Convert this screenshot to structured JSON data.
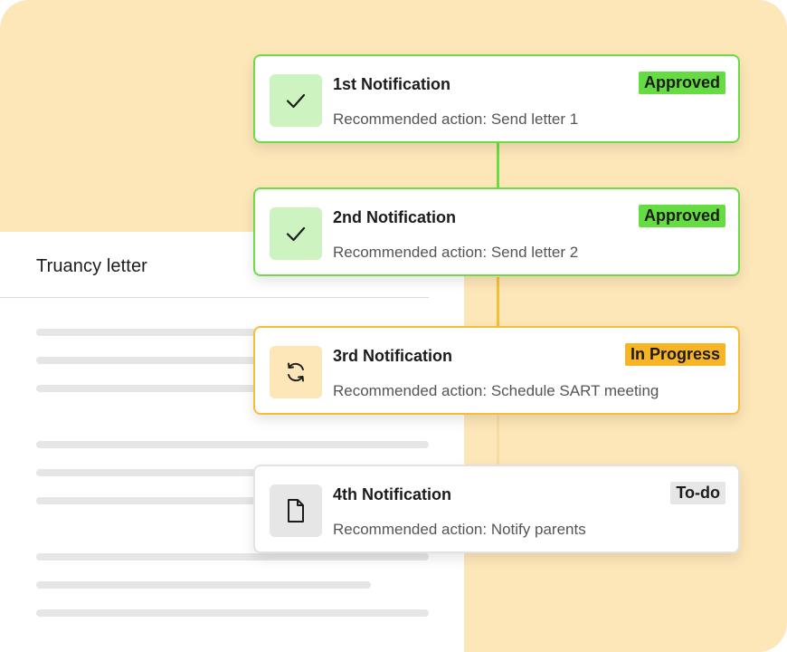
{
  "document": {
    "title": "Truancy letter"
  },
  "notifications": [
    {
      "title": "1st Notification",
      "action": "Recommended action: Send letter 1",
      "status": "Approved",
      "icon": "check-icon",
      "status_color": "#66dc43"
    },
    {
      "title": "2nd Notification",
      "action": "Recommended action: Send letter 2",
      "status": "Approved",
      "icon": "check-icon",
      "status_color": "#66dc43"
    },
    {
      "title": "3rd Notification",
      "action": "Recommended action: Schedule SART meeting",
      "status": "In Progress",
      "icon": "refresh-icon",
      "status_color": "#f7b424"
    },
    {
      "title": "4th Notification",
      "action": "Recommended action: Notify parents",
      "status": "To-do",
      "icon": "document-icon",
      "status_color": "#e6e6e6"
    }
  ],
  "colors": {
    "background": "#fde6b8",
    "approved_border": "#6cdc46",
    "in_progress_border": "#f6be36",
    "todo_border": "#e2e2e2"
  }
}
